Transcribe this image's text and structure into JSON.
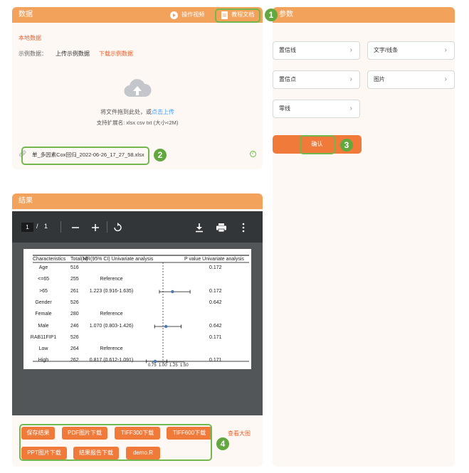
{
  "data_panel": {
    "title": "数据",
    "video_label": "操作视频",
    "docs_label": "教程文档",
    "local_data": "本地数据",
    "example_label": "示例数据：",
    "upload_example": "上传示例数据",
    "download_example": "下载示例数据",
    "drop_text": "将文件拖到此处，或",
    "click_upload": "点击上传",
    "supported_ext": "支持扩展名: xlsx csv txt (大小<2M)",
    "file_name": "单_多因素Cox回归_2022-06-26_17_27_58.xlsx"
  },
  "params_panel": {
    "title": "参数",
    "buttons": [
      "置信线",
      "文字/线条",
      "置信点",
      "图片",
      "零线"
    ],
    "confirm_label": "确认"
  },
  "result_panel": {
    "title": "结果",
    "page_current": "1",
    "page_sep": "/",
    "page_total": "1",
    "action_buttons_row1": [
      "保存结果",
      "PDF图片下载",
      "TIFF300下载",
      "TIFF600下载"
    ],
    "action_buttons_row2": [
      "PPT图片下载",
      "结果报告下载",
      "demo.R"
    ],
    "view_large": "查看大图"
  },
  "badges": [
    "1",
    "2",
    "3",
    "4"
  ],
  "icons": [
    "play-icon",
    "doc-icon",
    "cloud-upload-icon",
    "link-icon",
    "check-icon",
    "chevron-right-icon",
    "minus-icon",
    "plus-icon",
    "rotate-icon",
    "download-icon",
    "print-icon",
    "more-icon"
  ],
  "colors": {
    "header_orange": "#f2a25a",
    "button_orange": "#f07a3a",
    "annotation_green": "#72b84f",
    "pdf_toolbar": "#323639",
    "pdf_bg": "#525659"
  },
  "chart_data": {
    "type": "table",
    "headers": [
      "Characteristics",
      "Total(N)",
      "HR(95% CI) Univariate analysis",
      "P value Univariate analysis"
    ],
    "rows": [
      {
        "label": "Age",
        "n": "516",
        "hr": "",
        "p": "0.172"
      },
      {
        "label": "<=65",
        "n": "255",
        "hr": "Reference",
        "p": ""
      },
      {
        "label": ">65",
        "n": "261",
        "hr": "1.223 (0.916-1.635)",
        "p": "0.172"
      },
      {
        "label": "Gender",
        "n": "526",
        "hr": "",
        "p": "0.642"
      },
      {
        "label": "Female",
        "n": "280",
        "hr": "Reference",
        "p": ""
      },
      {
        "label": "Male",
        "n": "246",
        "hr": "1.070 (0.803-1.426)",
        "p": "0.642"
      },
      {
        "label": "RAB11FIP1",
        "n": "526",
        "hr": "",
        "p": "0.171"
      },
      {
        "label": "Low",
        "n": "264",
        "hr": "Reference",
        "p": ""
      },
      {
        "label": "High",
        "n": "262",
        "hr": "0.817 (0.612-1.091)",
        "p": "0.171"
      }
    ],
    "points": [
      {
        "row": 2,
        "hr": 1.223,
        "lo": 0.916,
        "hi": 1.635
      },
      {
        "row": 5,
        "hr": 1.07,
        "lo": 0.803,
        "hi": 1.426
      },
      {
        "row": 8,
        "hr": 0.817,
        "lo": 0.612,
        "hi": 1.091
      }
    ],
    "x_ticks": [
      "0.75",
      "1.00",
      "1.25",
      "1.50"
    ],
    "x_tick_values": [
      0.75,
      1.0,
      1.25,
      1.5
    ],
    "xlim": [
      0.75,
      1.5
    ],
    "reference_line": 1.0
  }
}
